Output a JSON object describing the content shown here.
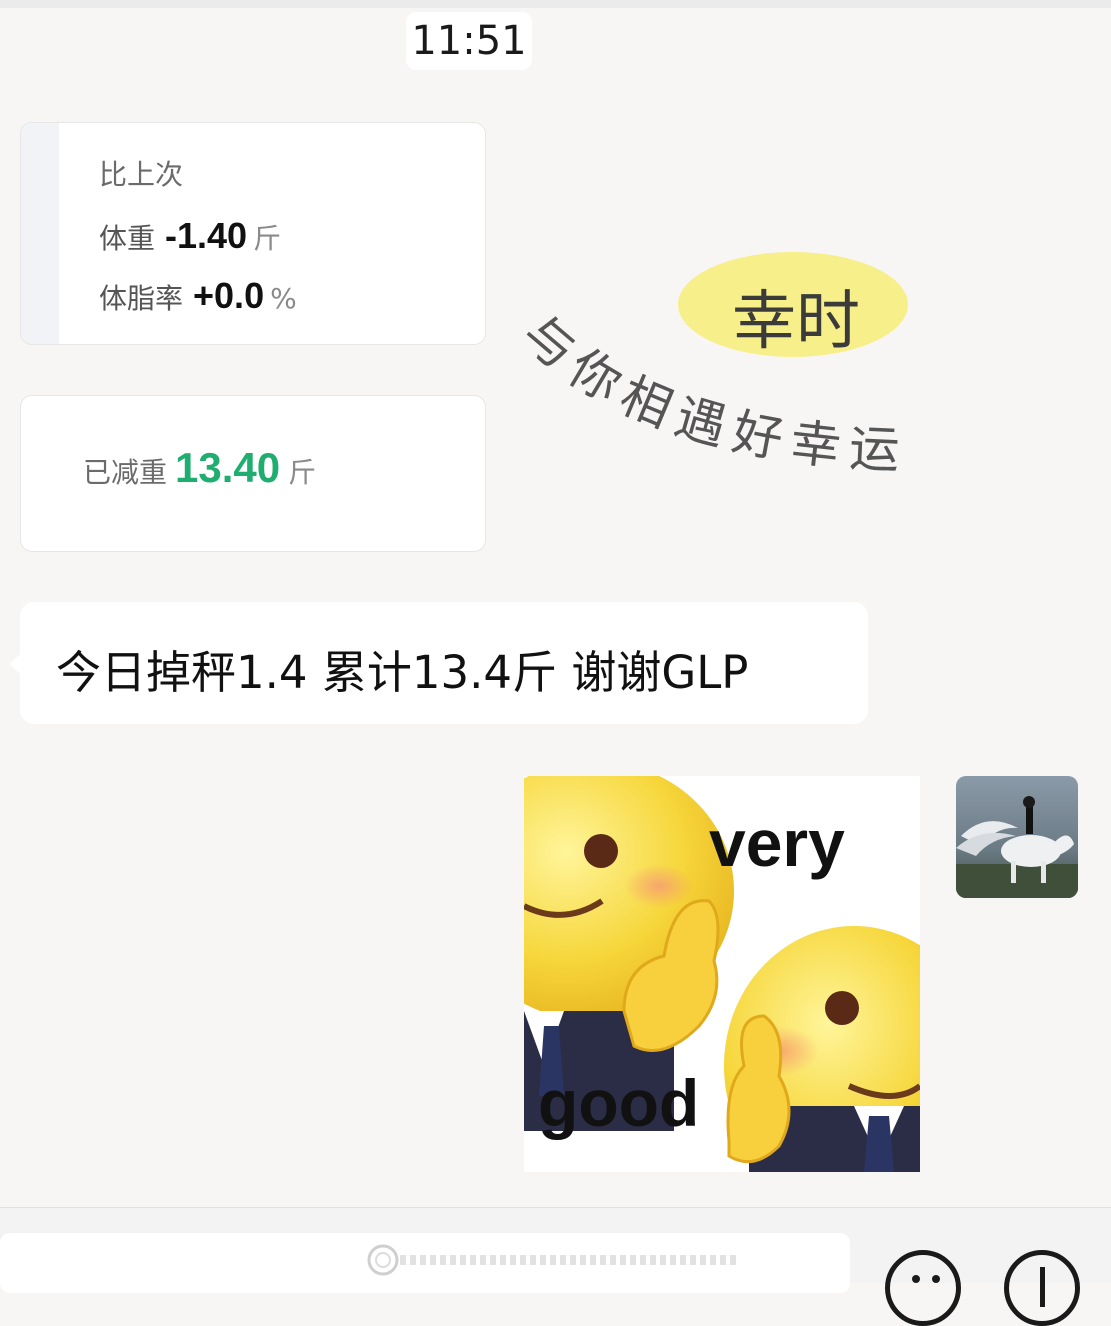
{
  "timestamp": "11:51",
  "card1": {
    "heading": "比上次",
    "weight_label": "体重",
    "weight_value": "-1.40",
    "weight_unit": "斤",
    "fat_label": "体脂率",
    "fat_value": "+0.0",
    "fat_unit": "%"
  },
  "card2": {
    "label": "已减重",
    "value": "13.40",
    "unit": "斤"
  },
  "decoration": {
    "badge_text": "幸时",
    "arc_text": "与你相遇好幸运"
  },
  "message": {
    "text": "今日掉秤1.4 累计13.4斤 谢谢GLP"
  },
  "sticker": {
    "top_text": "very",
    "bottom_text": "good"
  },
  "avatar": {
    "icon": "user-avatar-horse"
  },
  "bottom_bar": {
    "emoji_icon": "smiley-icon",
    "plus_icon": "plus-icon"
  }
}
